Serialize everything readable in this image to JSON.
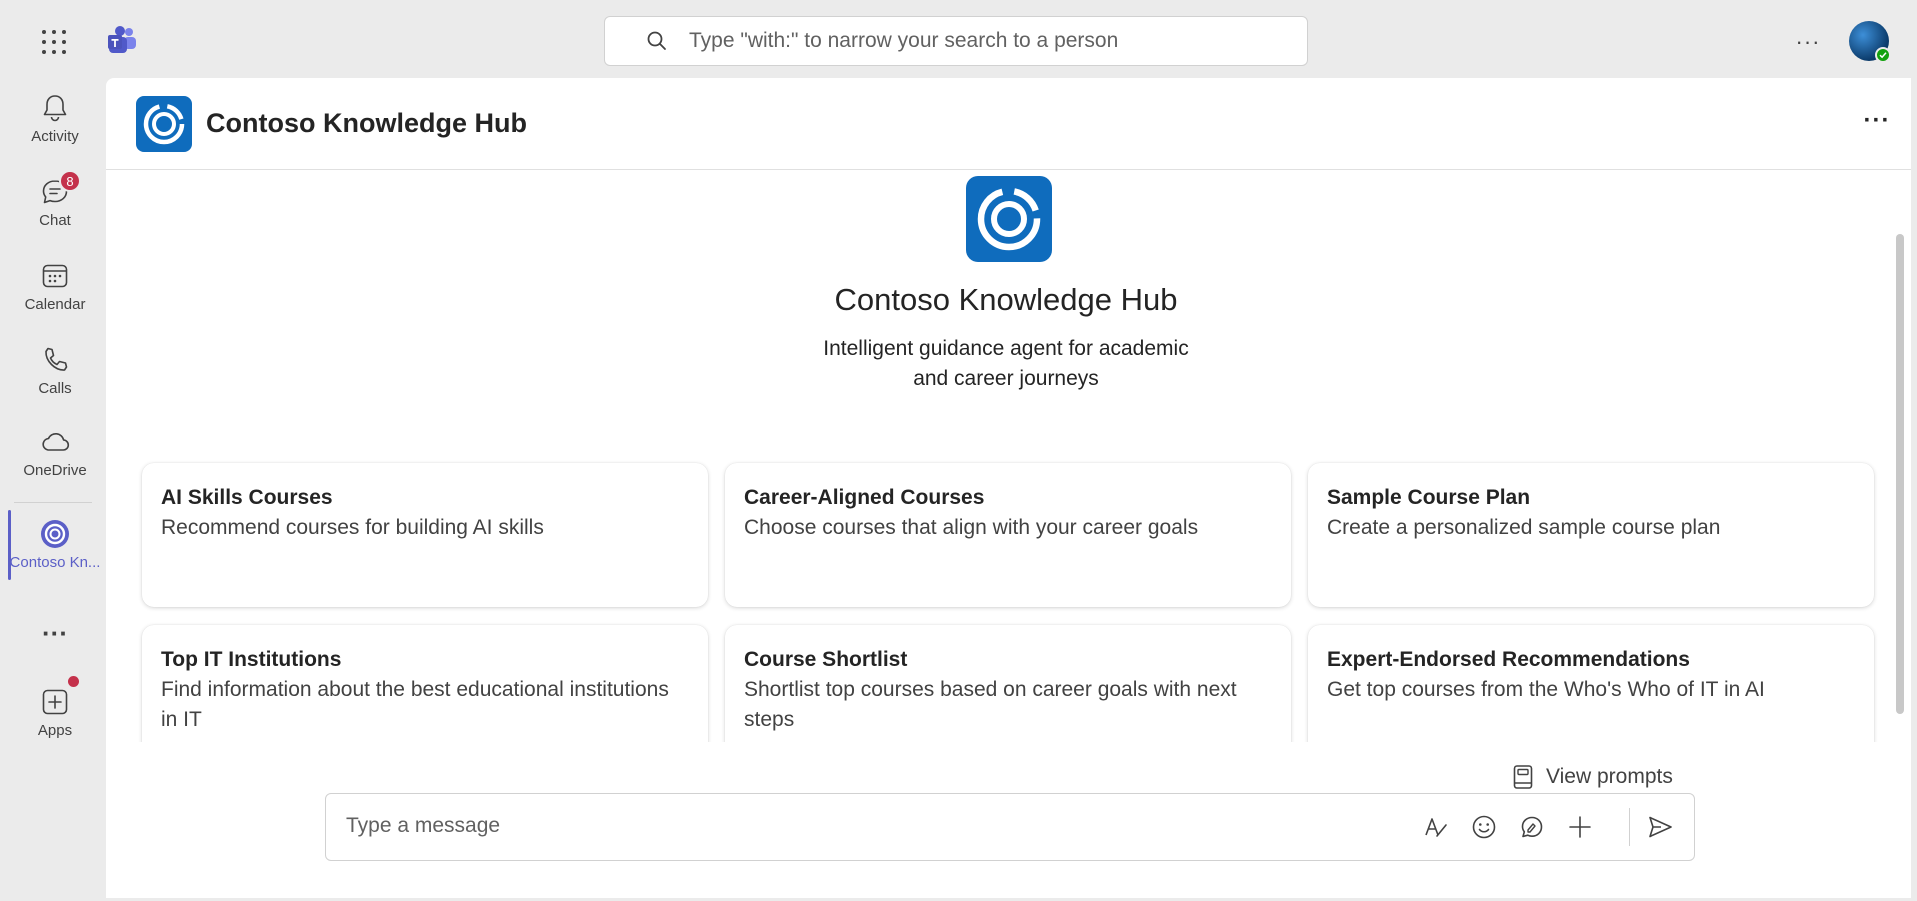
{
  "topbar": {
    "search_placeholder": "Type \"with:\" to narrow your search to a person",
    "more_label": "···",
    "apps_icon": "waffle-icon",
    "logo_icon": "teams-logo-icon"
  },
  "rail": {
    "items": [
      {
        "label": "Activity",
        "icon": "bell-icon"
      },
      {
        "label": "Chat",
        "icon": "chat-icon",
        "badge": "8"
      },
      {
        "label": "Calendar",
        "icon": "calendar-icon"
      },
      {
        "label": "Calls",
        "icon": "phone-icon"
      },
      {
        "label": "OneDrive",
        "icon": "cloud-icon"
      },
      {
        "label": "Contoso Kn...",
        "icon": "contoso-icon",
        "active": true
      },
      {
        "label": "···",
        "icon": "more-icon"
      },
      {
        "label": "Apps",
        "icon": "add-apps-icon"
      }
    ]
  },
  "app": {
    "title": "Contoso Knowledge Hub",
    "more_label": "···",
    "hero_title": "Contoso Knowledge Hub",
    "hero_description": "Intelligent guidance agent for academic and career journeys"
  },
  "cards": [
    {
      "title": "AI Skills Courses",
      "description": "Recommend courses for building AI skills"
    },
    {
      "title": "Career-Aligned Courses",
      "description": "Choose courses that align with your career goals"
    },
    {
      "title": "Sample Course Plan",
      "description": "Create a personalized sample course plan"
    },
    {
      "title": "Top IT Institutions",
      "description": "Find information about the best educational institutions in IT"
    },
    {
      "title": "Course Shortlist",
      "description": "Shortlist top courses based on career goals with next steps"
    },
    {
      "title": "Expert-Endorsed Recommendations",
      "description": "Get top courses from the Who's Who of IT in AI"
    }
  ],
  "composer": {
    "view_prompts_label": "View prompts",
    "placeholder": "Type a message"
  },
  "colors": {
    "accent": "#5b5fc7",
    "brand_blue": "#0f6cbd",
    "badge_red": "#c4314b",
    "presence_green": "#13a10e"
  }
}
